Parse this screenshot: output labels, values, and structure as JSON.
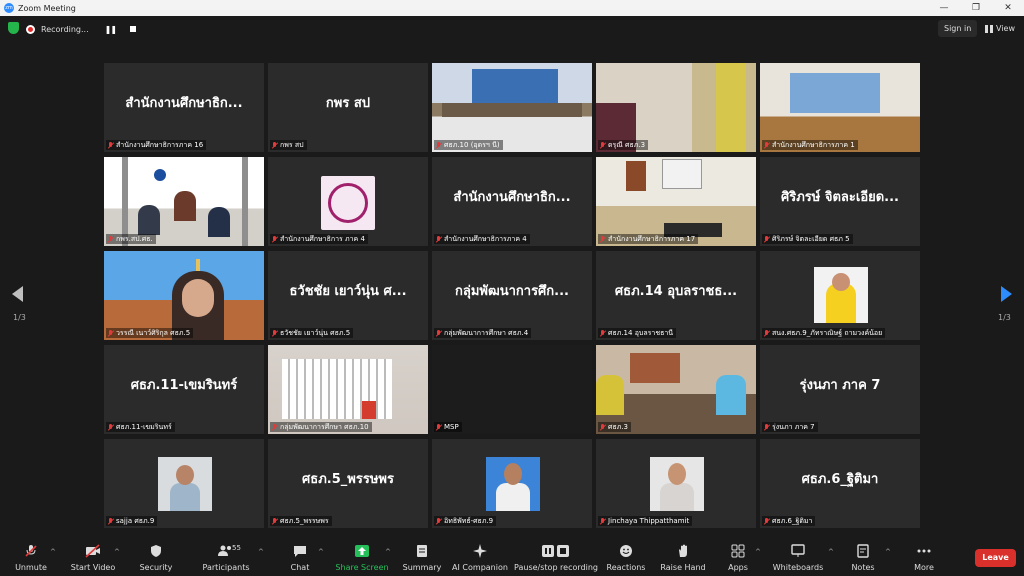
{
  "window": {
    "title": "Zoom Meeting",
    "minimize": "—",
    "restore": "❐",
    "close": "✕"
  },
  "topbar": {
    "recording_label": "Recording...",
    "signin": "Sign in",
    "view": "View"
  },
  "pager": {
    "left": "1/3",
    "right": "1/3"
  },
  "tiles": [
    {
      "name": "สำนักงานศึกษาธิการภาค 16",
      "big": "สำนักงานศึกษาธิก..."
    },
    {
      "name": "กพร สป",
      "big": "กพร สป"
    },
    {
      "name": "ศธภ.10 (อุดรฯ นี)",
      "big": ""
    },
    {
      "name": "ดรุณี ศธภ.3",
      "big": ""
    },
    {
      "name": "สำนักงานศึกษาธิการภาค 1",
      "big": ""
    },
    {
      "name": "กพร.สป.ศธ.",
      "big": ""
    },
    {
      "name": "สำนักงานศึกษาธิการ ภาค 4",
      "big": ""
    },
    {
      "name": "สำนักงานศึกษาธิการภาค 4",
      "big": "สำนักงานศึกษาธิก..."
    },
    {
      "name": "สำนักงานศึกษาธิการภาค 17",
      "big": ""
    },
    {
      "name": "ศิริภรษ์ จิตละเอียด ศธภ 5",
      "big": "ศิริภรษ์ จิตละเอียด..."
    },
    {
      "name": "วรรณี เนาว์ศิริกุล ศธภ.5",
      "big": ""
    },
    {
      "name": "ธวัชชัย เยาว์นุ่น ศธภ.5",
      "big": "ธวัชชัย เยาว์นุ่น ศ..."
    },
    {
      "name": "กลุ่มพัฒนาการศึกษา ศธภ.4",
      "big": "กลุ่มพัฒนาการศึก..."
    },
    {
      "name": "ศธภ.14 อุบลราชธานี",
      "big": "ศธภ.14 อุบลราชธ..."
    },
    {
      "name": "สนง.ศธภ.9_ภัทราณิษฐ์ ถามวงค์น้อย",
      "big": ""
    },
    {
      "name": "ศธภ.11-เขมรินทร์",
      "big": "ศธภ.11-เขมรินทร์"
    },
    {
      "name": "กลุ่มพัฒนาการศึกษา ศธภ.10",
      "big": ""
    },
    {
      "name": "MSP",
      "big": ""
    },
    {
      "name": "ศธภ.3",
      "big": ""
    },
    {
      "name": "รุ่งนภา ภาค 7",
      "big": "รุ่งนภา ภาค 7"
    },
    {
      "name": "sajja ศธภ.9",
      "big": ""
    },
    {
      "name": "ศธภ.5_พรรษพร",
      "big": "ศธภ.5_พรรษพร"
    },
    {
      "name": "อิทธิพัทธ์-ศธภ.9",
      "big": ""
    },
    {
      "name": "Jinchaya Thippatthamit",
      "big": ""
    },
    {
      "name": "ศธภ.6_ฐิติมา",
      "big": "ศธภ.6_ฐิติมา"
    }
  ],
  "toolbar": {
    "unmute": "Unmute",
    "start_video": "Start Video",
    "security": "Security",
    "participants": "Participants",
    "participants_count": "55",
    "chat": "Chat",
    "share_screen": "Share Screen",
    "summary": "Summary",
    "ai_companion": "AI Companion",
    "pause_stop": "Pause/stop recording",
    "reactions": "Reactions",
    "raise_hand": "Raise Hand",
    "apps": "Apps",
    "whiteboards": "Whiteboards",
    "notes": "Notes",
    "more": "More",
    "leave": "Leave"
  },
  "colors": {
    "accent": "#2d8cff",
    "active_speaker": "#b5e34d",
    "leave": "#d9302b",
    "share": "#25c05a",
    "mute": "#e23b3b"
  }
}
